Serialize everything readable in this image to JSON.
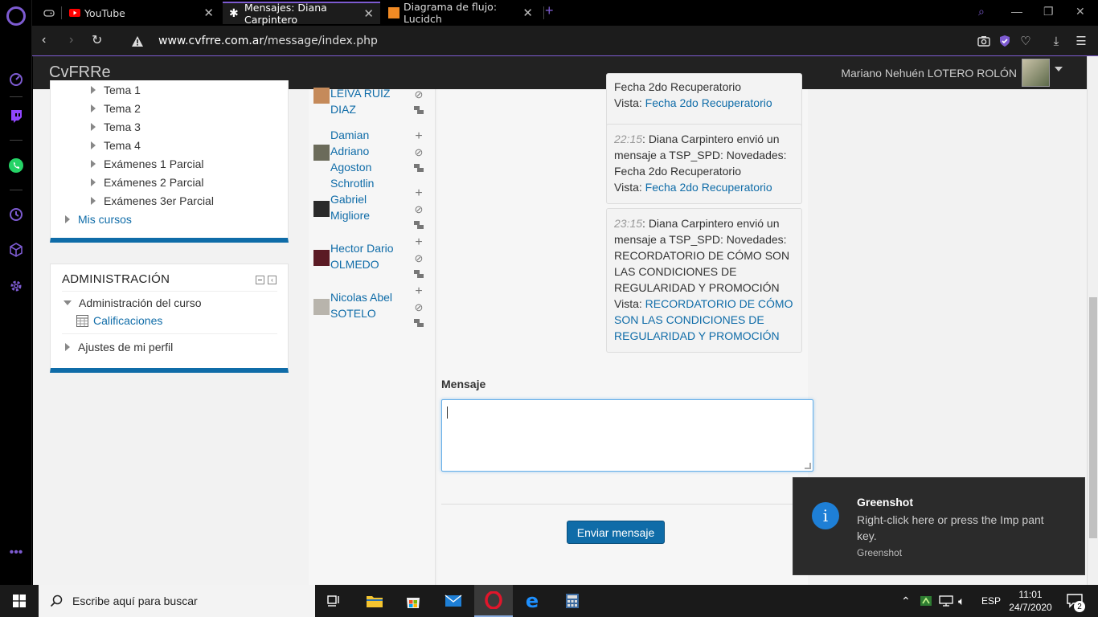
{
  "browser": {
    "tabs": [
      {
        "label": "",
        "icon": "gamepad-icon"
      },
      {
        "label": "YouTube",
        "icon": "youtube-icon"
      },
      {
        "label": "Mensajes: Diana Carpintero",
        "icon": "utn-icon",
        "active": true
      },
      {
        "label": "Diagrama de flujo: Lucidch",
        "icon": "lucidchart-icon"
      }
    ],
    "url_domain": "www.cvfrre.com.ar",
    "url_path": "/message/index.php"
  },
  "site": {
    "brand": "CvFRRe",
    "username": "Mariano Nehuén LOTERO ROLÓN"
  },
  "nav_block": {
    "items": [
      {
        "label": "Tema 1"
      },
      {
        "label": "Tema 2"
      },
      {
        "label": "Tema 3"
      },
      {
        "label": "Tema 4"
      },
      {
        "label": "Exámenes 1 Parcial"
      },
      {
        "label": "Exámenes 2 Parcial"
      },
      {
        "label": "Exámenes 3er Parcial"
      }
    ],
    "mis_cursos": "Mis cursos"
  },
  "admin_block": {
    "title": "ADMINISTRACIÓN",
    "curso": "Administración del curso",
    "calificaciones": "Calificaciones",
    "ajustes": "Ajustes de mi perfil"
  },
  "contacts": [
    {
      "name": "LEIVA RUIZ DIAZ"
    },
    {
      "name": "Damian Adriano Agoston Schrotlin"
    },
    {
      "name": "Gabriel Migliore"
    },
    {
      "name": "Hector Dario OLMEDO"
    },
    {
      "name": "Nicolas Abel SOTELO"
    }
  ],
  "messages": [
    {
      "top_text": "Fecha 2do Recuperatorio",
      "vista_label": "Vista:",
      "vista_link": "Fecha 2do Recuperatorio"
    },
    {
      "time": "22:15",
      "text": ": Diana Carpintero envió un mensaje a TSP_SPD: Novedades: Fecha 2do Recuperatorio",
      "vista_label": "Vista:",
      "vista_link": "Fecha 2do Recuperatorio"
    },
    {
      "time": "23:15",
      "text": ": Diana Carpintero envió un mensaje a TSP_SPD: Novedades: RECORDATORIO DE CÓMO SON LAS CONDICIONES DE REGULARIDAD Y PROMOCIÓN",
      "vista_label": "Vista:",
      "vista_link": "RECORDATORIO DE CÓMO SON LAS CONDICIONES DE REGULARIDAD Y PROMOCIÓN"
    }
  ],
  "compose": {
    "label": "Mensaje",
    "value": "",
    "send_label": "Enviar mensaje"
  },
  "toast": {
    "title": "Greenshot",
    "text": "Right-click here or press the Imp pant key.",
    "source": "Greenshot"
  },
  "taskbar": {
    "search_placeholder": "Escribe aquí para buscar",
    "lang": "ESP",
    "time": "11:01",
    "date": "24/7/2020",
    "notif_count": "2"
  },
  "colors": {
    "accent": "#7d5bd1",
    "link": "#0f6ca8",
    "header": "#222222"
  }
}
